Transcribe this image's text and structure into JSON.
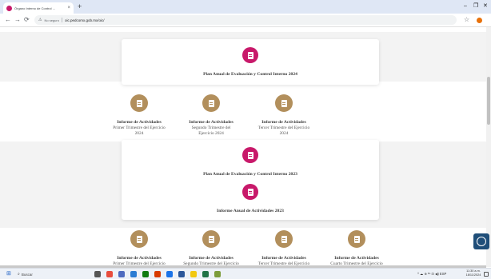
{
  "browser": {
    "tab_title": "Órgano Interno de Control ...",
    "tab_close": "×",
    "new_tab": "+",
    "tab_dropdown": "⌄",
    "window_controls": {
      "minimize": "–",
      "maximize": "❐",
      "close": "✕"
    },
    "nav": {
      "back": "←",
      "forward": "→",
      "reload": "⟳"
    },
    "not_secure_label": "No seguro",
    "url": "oic.pedcomx.gob.mx/oic/"
  },
  "sections": {
    "card1_title": "Plan Anual de Evaluación y Control Interno 2024",
    "row1": [
      {
        "title": "Informe de Actividades",
        "sub1": "Primer Trimestre del Ejercicio",
        "sub2": "2024"
      },
      {
        "title": "Informe de Actividades",
        "sub1": "Segundo Trimestre del",
        "sub2": "Ejercicio 2024"
      },
      {
        "title": "Informe de Actividades",
        "sub1": "Tercer Trimestre del Ejercicio",
        "sub2": "2024"
      }
    ],
    "card2_title_a": "Plan Anual de Evaluación y Control Interno 2023",
    "card2_title_b": "Informe Anual de Actividades 2023",
    "row2": [
      {
        "title": "Informe de Actividades",
        "sub1": "Primer Trimestre del Ejercicio"
      },
      {
        "title": "Informe de Actividades",
        "sub1": "Segundo Trimestre del Ejercicio"
      },
      {
        "title": "Informe de Actividades",
        "sub1": "Tercer Trimestre del Ejercicio"
      },
      {
        "title": "Informe de Actividades",
        "sub1": "Cuarto Trimestre del Ejercicio"
      }
    ]
  },
  "taskbar": {
    "search_placeholder": "Buscar",
    "tray_text": "^ ☁ ⊕ ᴱˢ ⊡ ◀) ESP",
    "time": "11:30 a.m.",
    "date": "18/11/2024"
  },
  "colors": {
    "magenta": "#c8196a",
    "gold": "#b28f5c",
    "taskbar": "#edf1f7"
  }
}
